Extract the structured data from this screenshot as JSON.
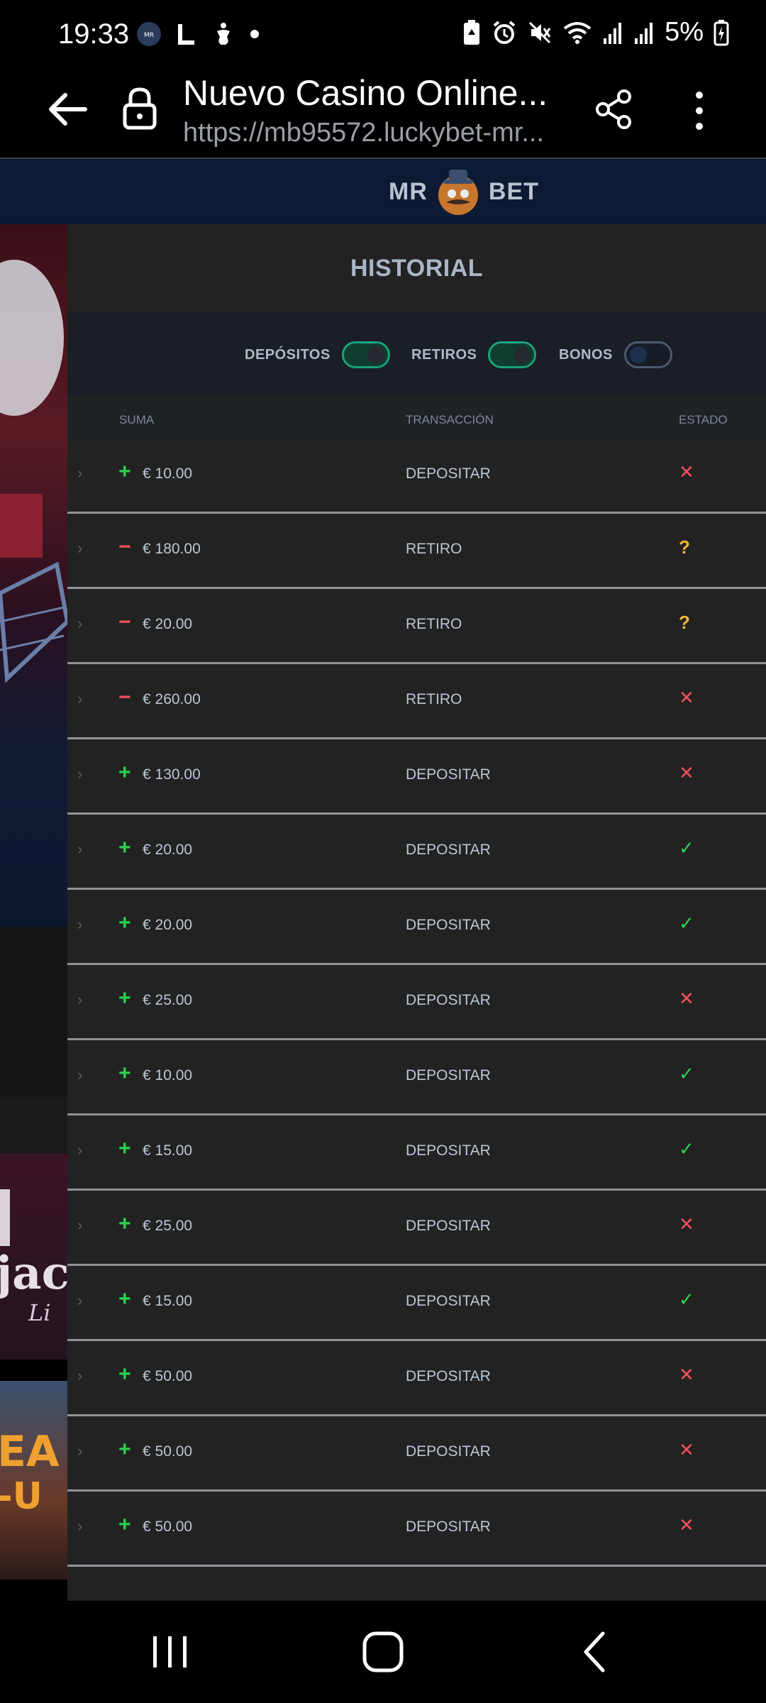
{
  "status_bar": {
    "time": "19:33",
    "battery": "5%",
    "left_icons": [
      "mrbet-notification-icon",
      "l-app-icon",
      "accessibility-icon",
      "dot-icon"
    ],
    "right_icons": [
      "battery-saver-icon",
      "alarm-icon",
      "mute-icon",
      "wifi-icon",
      "signal-icon",
      "signal-icon",
      "battery-charging-icon"
    ]
  },
  "browser": {
    "title": "Nuevo Casino Online...",
    "url": "https://mb95572.luckybet-mr..."
  },
  "site": {
    "logo_left": "MR",
    "logo_right": "BET"
  },
  "panel": {
    "title": "HISTORIAL",
    "filters": [
      {
        "label": "DEPÓSITOS",
        "on": true
      },
      {
        "label": "RETIROS",
        "on": true
      },
      {
        "label": "BONOS",
        "on": false
      }
    ],
    "columns": {
      "amount": "SUMA",
      "transaction": "TRANSACCIÓN",
      "status": "ESTADO"
    },
    "rows": [
      {
        "sign": "+",
        "amount": "€ 10.00",
        "type": "DEPOSITAR",
        "status": "fail"
      },
      {
        "sign": "−",
        "amount": "€ 180.00",
        "type": "RETIRO",
        "status": "pending"
      },
      {
        "sign": "−",
        "amount": "€ 20.00",
        "type": "RETIRO",
        "status": "pending"
      },
      {
        "sign": "−",
        "amount": "€ 260.00",
        "type": "RETIRO",
        "status": "fail"
      },
      {
        "sign": "+",
        "amount": "€ 130.00",
        "type": "DEPOSITAR",
        "status": "fail"
      },
      {
        "sign": "+",
        "amount": "€ 20.00",
        "type": "DEPOSITAR",
        "status": "ok"
      },
      {
        "sign": "+",
        "amount": "€ 20.00",
        "type": "DEPOSITAR",
        "status": "ok"
      },
      {
        "sign": "+",
        "amount": "€ 25.00",
        "type": "DEPOSITAR",
        "status": "fail"
      },
      {
        "sign": "+",
        "amount": "€ 10.00",
        "type": "DEPOSITAR",
        "status": "ok"
      },
      {
        "sign": "+",
        "amount": "€ 15.00",
        "type": "DEPOSITAR",
        "status": "ok"
      },
      {
        "sign": "+",
        "amount": "€ 25.00",
        "type": "DEPOSITAR",
        "status": "fail"
      },
      {
        "sign": "+",
        "amount": "€ 15.00",
        "type": "DEPOSITAR",
        "status": "ok"
      },
      {
        "sign": "+",
        "amount": "€ 50.00",
        "type": "DEPOSITAR",
        "status": "fail"
      },
      {
        "sign": "+",
        "amount": "€ 50.00",
        "type": "DEPOSITAR",
        "status": "fail"
      },
      {
        "sign": "+",
        "amount": "€ 50.00",
        "type": "DEPOSITAR",
        "status": "fail"
      }
    ],
    "status_glyphs": {
      "fail": "✕",
      "pending": "?",
      "ok": "✓"
    }
  },
  "colors": {
    "panel_bg": "#222223",
    "header_bg": "#0c1a33",
    "toggle_on": "#1aa37a",
    "positive": "#2ed14e",
    "negative": "#f2505a",
    "pending": "#f4b638"
  }
}
